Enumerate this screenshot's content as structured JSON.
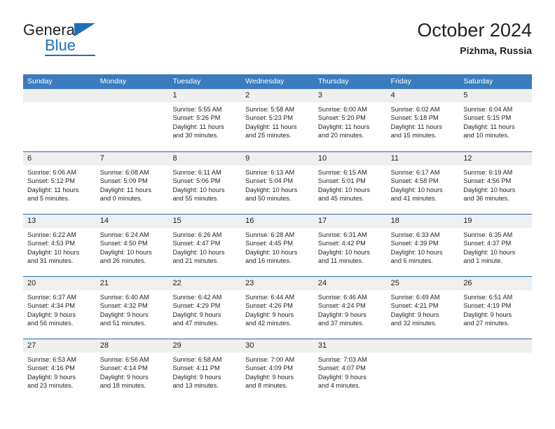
{
  "brand": {
    "name_top": "General",
    "name_bottom": "Blue",
    "triangle_icon": "brand-triangle-icon",
    "accent_color": "#1d70b8"
  },
  "header": {
    "title": "October 2024",
    "subtitle": "Pizhma, Russia"
  },
  "calendar": {
    "header_bg_color": "#3a7cbe",
    "row_line_color": "#1f6cb0",
    "day_band_color": "#efefef",
    "weekdays": [
      "Sunday",
      "Monday",
      "Tuesday",
      "Wednesday",
      "Thursday",
      "Friday",
      "Saturday"
    ],
    "weeks": [
      [
        {
          "day": "",
          "sunrise": "",
          "sunset": "",
          "daylight_line1": "",
          "daylight_line2": "",
          "empty": true
        },
        {
          "day": "",
          "sunrise": "",
          "sunset": "",
          "daylight_line1": "",
          "daylight_line2": "",
          "empty": true
        },
        {
          "day": "1",
          "sunrise": "Sunrise: 5:55 AM",
          "sunset": "Sunset: 5:26 PM",
          "daylight_line1": "Daylight: 11 hours",
          "daylight_line2": "and 30 minutes."
        },
        {
          "day": "2",
          "sunrise": "Sunrise: 5:58 AM",
          "sunset": "Sunset: 5:23 PM",
          "daylight_line1": "Daylight: 11 hours",
          "daylight_line2": "and 25 minutes."
        },
        {
          "day": "3",
          "sunrise": "Sunrise: 6:00 AM",
          "sunset": "Sunset: 5:20 PM",
          "daylight_line1": "Daylight: 11 hours",
          "daylight_line2": "and 20 minutes."
        },
        {
          "day": "4",
          "sunrise": "Sunrise: 6:02 AM",
          "sunset": "Sunset: 5:18 PM",
          "daylight_line1": "Daylight: 11 hours",
          "daylight_line2": "and 15 minutes."
        },
        {
          "day": "5",
          "sunrise": "Sunrise: 6:04 AM",
          "sunset": "Sunset: 5:15 PM",
          "daylight_line1": "Daylight: 11 hours",
          "daylight_line2": "and 10 minutes."
        }
      ],
      [
        {
          "day": "6",
          "sunrise": "Sunrise: 6:06 AM",
          "sunset": "Sunset: 5:12 PM",
          "daylight_line1": "Daylight: 11 hours",
          "daylight_line2": "and 5 minutes."
        },
        {
          "day": "7",
          "sunrise": "Sunrise: 6:08 AM",
          "sunset": "Sunset: 5:09 PM",
          "daylight_line1": "Daylight: 11 hours",
          "daylight_line2": "and 0 minutes."
        },
        {
          "day": "8",
          "sunrise": "Sunrise: 6:11 AM",
          "sunset": "Sunset: 5:06 PM",
          "daylight_line1": "Daylight: 10 hours",
          "daylight_line2": "and 55 minutes."
        },
        {
          "day": "9",
          "sunrise": "Sunrise: 6:13 AM",
          "sunset": "Sunset: 5:04 PM",
          "daylight_line1": "Daylight: 10 hours",
          "daylight_line2": "and 50 minutes."
        },
        {
          "day": "10",
          "sunrise": "Sunrise: 6:15 AM",
          "sunset": "Sunset: 5:01 PM",
          "daylight_line1": "Daylight: 10 hours",
          "daylight_line2": "and 45 minutes."
        },
        {
          "day": "11",
          "sunrise": "Sunrise: 6:17 AM",
          "sunset": "Sunset: 4:58 PM",
          "daylight_line1": "Daylight: 10 hours",
          "daylight_line2": "and 41 minutes."
        },
        {
          "day": "12",
          "sunrise": "Sunrise: 6:19 AM",
          "sunset": "Sunset: 4:56 PM",
          "daylight_line1": "Daylight: 10 hours",
          "daylight_line2": "and 36 minutes."
        }
      ],
      [
        {
          "day": "13",
          "sunrise": "Sunrise: 6:22 AM",
          "sunset": "Sunset: 4:53 PM",
          "daylight_line1": "Daylight: 10 hours",
          "daylight_line2": "and 31 minutes."
        },
        {
          "day": "14",
          "sunrise": "Sunrise: 6:24 AM",
          "sunset": "Sunset: 4:50 PM",
          "daylight_line1": "Daylight: 10 hours",
          "daylight_line2": "and 26 minutes."
        },
        {
          "day": "15",
          "sunrise": "Sunrise: 6:26 AM",
          "sunset": "Sunset: 4:47 PM",
          "daylight_line1": "Daylight: 10 hours",
          "daylight_line2": "and 21 minutes."
        },
        {
          "day": "16",
          "sunrise": "Sunrise: 6:28 AM",
          "sunset": "Sunset: 4:45 PM",
          "daylight_line1": "Daylight: 10 hours",
          "daylight_line2": "and 16 minutes."
        },
        {
          "day": "17",
          "sunrise": "Sunrise: 6:31 AM",
          "sunset": "Sunset: 4:42 PM",
          "daylight_line1": "Daylight: 10 hours",
          "daylight_line2": "and 11 minutes."
        },
        {
          "day": "18",
          "sunrise": "Sunrise: 6:33 AM",
          "sunset": "Sunset: 4:39 PM",
          "daylight_line1": "Daylight: 10 hours",
          "daylight_line2": "and 6 minutes."
        },
        {
          "day": "19",
          "sunrise": "Sunrise: 6:35 AM",
          "sunset": "Sunset: 4:37 PM",
          "daylight_line1": "Daylight: 10 hours",
          "daylight_line2": "and 1 minute."
        }
      ],
      [
        {
          "day": "20",
          "sunrise": "Sunrise: 6:37 AM",
          "sunset": "Sunset: 4:34 PM",
          "daylight_line1": "Daylight: 9 hours",
          "daylight_line2": "and 56 minutes."
        },
        {
          "day": "21",
          "sunrise": "Sunrise: 6:40 AM",
          "sunset": "Sunset: 4:32 PM",
          "daylight_line1": "Daylight: 9 hours",
          "daylight_line2": "and 51 minutes."
        },
        {
          "day": "22",
          "sunrise": "Sunrise: 6:42 AM",
          "sunset": "Sunset: 4:29 PM",
          "daylight_line1": "Daylight: 9 hours",
          "daylight_line2": "and 47 minutes."
        },
        {
          "day": "23",
          "sunrise": "Sunrise: 6:44 AM",
          "sunset": "Sunset: 4:26 PM",
          "daylight_line1": "Daylight: 9 hours",
          "daylight_line2": "and 42 minutes."
        },
        {
          "day": "24",
          "sunrise": "Sunrise: 6:46 AM",
          "sunset": "Sunset: 4:24 PM",
          "daylight_line1": "Daylight: 9 hours",
          "daylight_line2": "and 37 minutes."
        },
        {
          "day": "25",
          "sunrise": "Sunrise: 6:49 AM",
          "sunset": "Sunset: 4:21 PM",
          "daylight_line1": "Daylight: 9 hours",
          "daylight_line2": "and 32 minutes."
        },
        {
          "day": "26",
          "sunrise": "Sunrise: 6:51 AM",
          "sunset": "Sunset: 4:19 PM",
          "daylight_line1": "Daylight: 9 hours",
          "daylight_line2": "and 27 minutes."
        }
      ],
      [
        {
          "day": "27",
          "sunrise": "Sunrise: 6:53 AM",
          "sunset": "Sunset: 4:16 PM",
          "daylight_line1": "Daylight: 9 hours",
          "daylight_line2": "and 23 minutes."
        },
        {
          "day": "28",
          "sunrise": "Sunrise: 6:56 AM",
          "sunset": "Sunset: 4:14 PM",
          "daylight_line1": "Daylight: 9 hours",
          "daylight_line2": "and 18 minutes."
        },
        {
          "day": "29",
          "sunrise": "Sunrise: 6:58 AM",
          "sunset": "Sunset: 4:11 PM",
          "daylight_line1": "Daylight: 9 hours",
          "daylight_line2": "and 13 minutes."
        },
        {
          "day": "30",
          "sunrise": "Sunrise: 7:00 AM",
          "sunset": "Sunset: 4:09 PM",
          "daylight_line1": "Daylight: 9 hours",
          "daylight_line2": "and 8 minutes."
        },
        {
          "day": "31",
          "sunrise": "Sunrise: 7:03 AM",
          "sunset": "Sunset: 4:07 PM",
          "daylight_line1": "Daylight: 9 hours",
          "daylight_line2": "and 4 minutes."
        },
        {
          "day": "",
          "sunrise": "",
          "sunset": "",
          "daylight_line1": "",
          "daylight_line2": "",
          "empty": true
        },
        {
          "day": "",
          "sunrise": "",
          "sunset": "",
          "daylight_line1": "",
          "daylight_line2": "",
          "empty": true
        }
      ]
    ]
  }
}
